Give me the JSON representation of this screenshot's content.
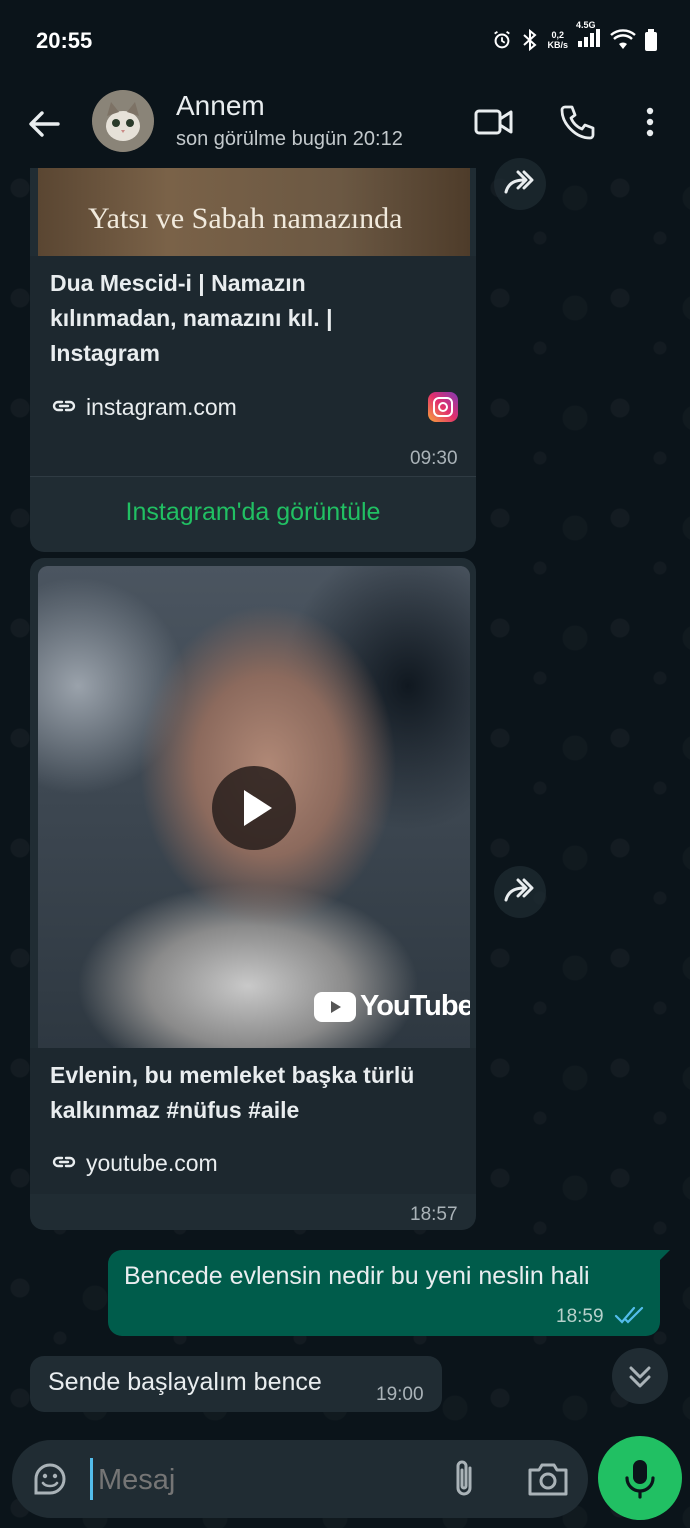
{
  "status_bar": {
    "time": "20:55",
    "network_speed": "0,2",
    "network_speed_unit": "KB/s",
    "network_type": "4.5G"
  },
  "header": {
    "contact_name": "Annem",
    "last_seen": "son görülme bugün 20:12"
  },
  "messages": {
    "instagram": {
      "image_caption": "Yatsı ve Sabah namazında",
      "title_lines": [
        "Dua Mescid-i | Namazın",
        "kılınmadan, namazını kıl. |",
        "Instagram"
      ],
      "domain": "instagram.com",
      "time": "09:30",
      "action_label": "Instagram'da görüntüle"
    },
    "youtube": {
      "brand_label": "YouTube",
      "title_lines": [
        "Evlenin, bu memleket başka türlü",
        "kalkınmaz #nüfus #aile"
      ],
      "domain": "youtube.com",
      "time": "18:57"
    },
    "outgoing": {
      "text": "Bencede evlensin nedir bu yeni neslin hali",
      "time": "18:59"
    },
    "incoming": {
      "text": "Sende başlayalım bence",
      "time": "19:00"
    }
  },
  "composer": {
    "placeholder": "Mesaj"
  },
  "colors": {
    "accent_green": "#21c063",
    "link_green": "#21c063",
    "outgoing_bubble": "#005c4b",
    "incoming_bubble": "#202c33",
    "read_ticks": "#53bdeb"
  }
}
